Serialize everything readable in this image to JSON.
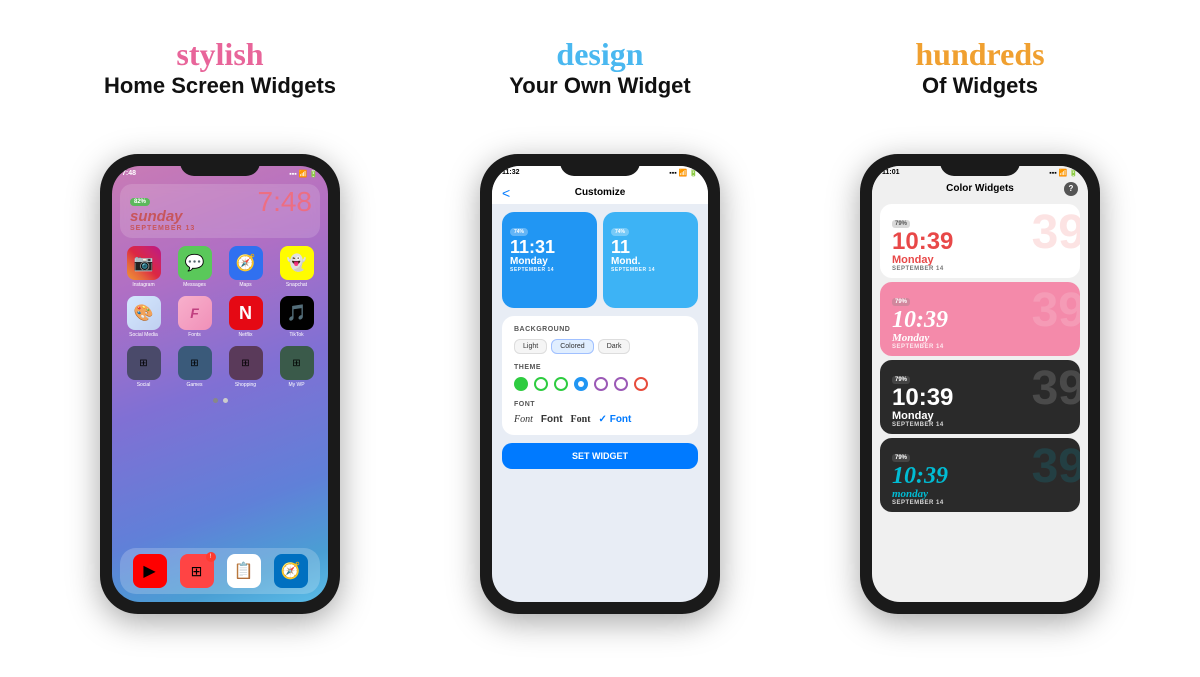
{
  "panels": [
    {
      "id": "panel1",
      "script_title": "stylish",
      "script_color": "#e8659a",
      "bold_title": "Home Screen Widgets"
    },
    {
      "id": "panel2",
      "script_title": "design",
      "script_color": "#4ab8f0",
      "bold_title": "Your Own Widget"
    },
    {
      "id": "panel3",
      "script_title": "hundreds",
      "script_color": "#f0a030",
      "bold_title": "Of Widgets"
    }
  ],
  "phone1": {
    "status_time": "7:48",
    "battery": "82%",
    "day": "sunday",
    "date": "SEPTEMBER 13",
    "big_time": "7:48",
    "apps_row1": [
      {
        "label": "Instagram",
        "color": "#c13584",
        "icon": "📷"
      },
      {
        "label": "Messages",
        "color": "#5ac85a",
        "icon": "💬"
      },
      {
        "label": "Maps",
        "color": "#3070f0",
        "icon": "🧭"
      },
      {
        "label": "Snapchat",
        "color": "#fffc00",
        "icon": "👻"
      }
    ],
    "apps_row2": [
      {
        "label": "Social Media",
        "color": "#e0e0e0",
        "icon": "🎨"
      },
      {
        "label": "Fonts",
        "color": "#f0a0c0",
        "icon": "Ƒ"
      },
      {
        "label": "Netflix",
        "color": "#e50914",
        "icon": "N"
      },
      {
        "label": "TikTok",
        "color": "#010101",
        "icon": "♪"
      }
    ],
    "apps_row3": [
      {
        "label": "Social",
        "color": "#3a3a3a",
        "icon": "⊞"
      },
      {
        "label": "Games",
        "color": "#4a4a4a",
        "icon": "⊞"
      },
      {
        "label": "Shopping",
        "color": "#5a3a3a",
        "icon": "⊞"
      },
      {
        "label": "My WP",
        "color": "#3a4a3a",
        "icon": "⊞"
      }
    ],
    "dock": [
      "YouTube",
      "Grid",
      "Notion",
      "Safari"
    ]
  },
  "phone2": {
    "status_time": "11:32",
    "title": "Customize",
    "back_label": "<",
    "widget1_battery": "74%",
    "widget1_time": "11:31",
    "widget1_day": "Monday",
    "widget1_date": "SEPTEMBER 14",
    "widget2_battery": "74%",
    "widget2_time": "11",
    "widget2_day": "Mond.",
    "widget2_date": "SEPTEMBER 14",
    "sections": {
      "background_label": "BACKGROUND",
      "background_options": [
        "Light",
        "Colored",
        "Dark"
      ],
      "theme_label": "THEME",
      "theme_colors": [
        "#2ecc40",
        "#2ecc40",
        "#2ecc40",
        "#2196f3",
        "#9b59b6",
        "#9b59b6",
        "#e74c3c"
      ],
      "font_label": "FONT",
      "font_options": [
        "Font",
        "Font",
        "Font",
        "✓ Font"
      ]
    },
    "set_widget_label": "SET WIDGET"
  },
  "phone3": {
    "status_time": "11:01",
    "title": "Color Widgets",
    "help_label": "?",
    "widgets": [
      {
        "style": "light",
        "battery": "79%",
        "time": "10:39",
        "day": "Monday",
        "date": "SEPTEMBER 14",
        "color": "coral"
      },
      {
        "style": "pink",
        "battery": "79%",
        "time": "10:39",
        "day": "Monday",
        "date": "SEPTEMBER 14",
        "color": "white",
        "script": true
      },
      {
        "style": "dark",
        "battery": "79%",
        "time": "10:39",
        "day": "Monday",
        "date": "SEPTEMBER 14",
        "color": "white"
      },
      {
        "style": "teal",
        "battery": "79%",
        "time": "10:39",
        "day": "monday",
        "date": "SEPTEMBER 14",
        "color": "teal",
        "script": true
      }
    ]
  }
}
